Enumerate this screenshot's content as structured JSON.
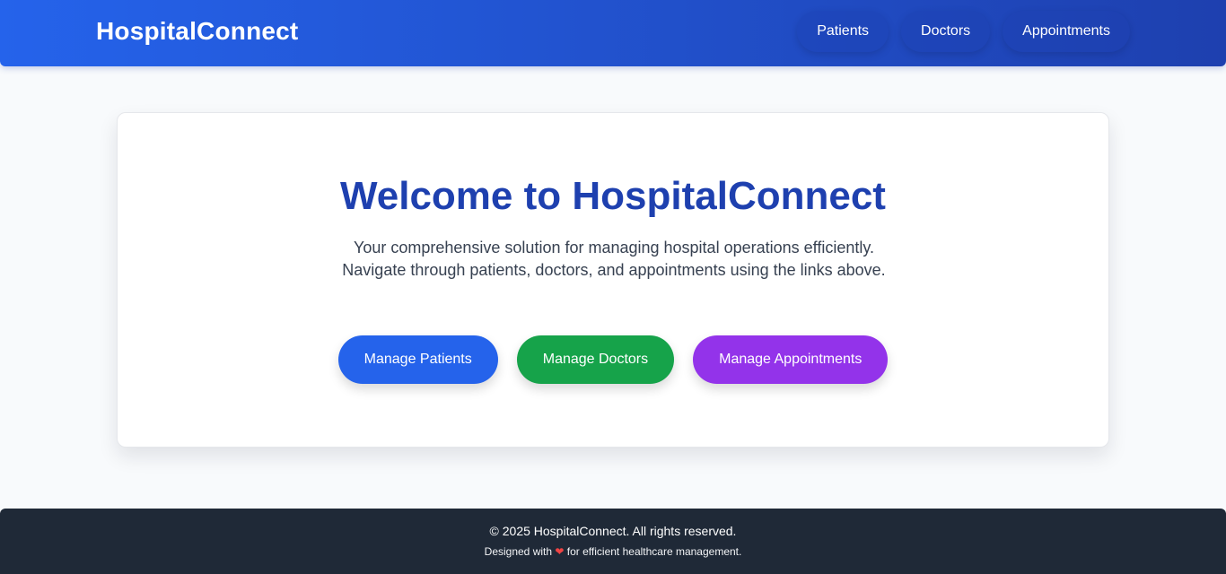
{
  "navbar": {
    "brand": "HospitalConnect",
    "links": [
      {
        "label": "Patients"
      },
      {
        "label": "Doctors"
      },
      {
        "label": "Appointments"
      }
    ]
  },
  "hero": {
    "title": "Welcome to HospitalConnect",
    "description": "Your comprehensive solution for managing hospital operations efficiently. Navigate through patients, doctors, and appointments using the links above.",
    "buttons": [
      {
        "label": "Manage Patients",
        "color": "#2563eb"
      },
      {
        "label": "Manage Doctors",
        "color": "#16a34a"
      },
      {
        "label": "Manage Appointments",
        "color": "#9333ea"
      }
    ]
  },
  "footer": {
    "copyright": "© 2025 HospitalConnect. All rights reserved.",
    "tagline_prefix": "Designed with",
    "heart_icon": "heart-icon",
    "tagline_suffix": "for efficient healthcare management."
  },
  "colors": {
    "nav_gradient_start": "#2563eb",
    "nav_gradient_end": "#1e40af",
    "title": "#1e40af",
    "footer_bg": "#1f2937",
    "page_bg": "#f8fafc"
  }
}
